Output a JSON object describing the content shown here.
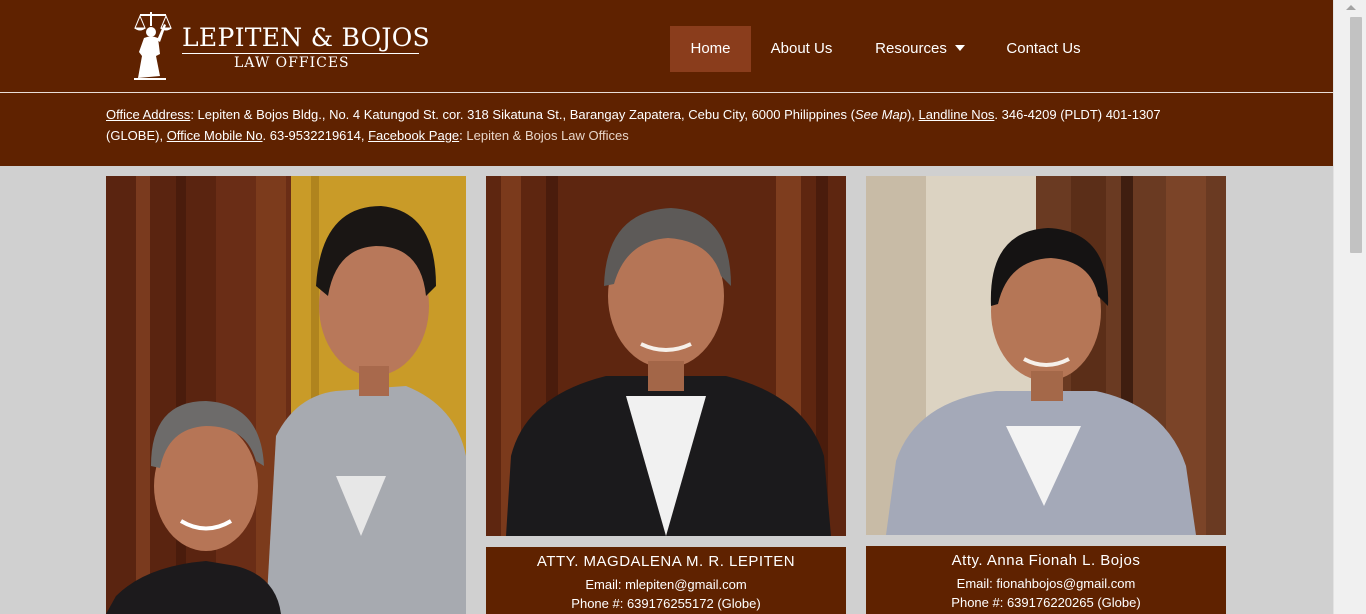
{
  "brand": {
    "title": "LEPITEN & BOJOS",
    "subtitle": "LAW OFFICES"
  },
  "nav": {
    "items": [
      {
        "label": "Home",
        "active": true
      },
      {
        "label": "About Us"
      },
      {
        "label": "Resources",
        "has_dropdown": true
      },
      {
        "label": "Contact Us"
      }
    ]
  },
  "info": {
    "office_address_label": "Office Address",
    "office_address": ": Lepiten & Bojos Bldg., No. 4 Katungod St. cor. 318 Sikatuna St., Barangay Zapatera, Cebu City, 6000 Philippines (",
    "see_map": "See Map",
    "close_paren": "), ",
    "landline_label": "Landline Nos",
    "landline": ". 346-4209 (PLDT) 401-1307 (GLOBE), ",
    "mobile_label": "Office Mobile No",
    "mobile": ". 63-9532219614, ",
    "facebook_label": "Facebook Page",
    "facebook_colon": ": ",
    "facebook": "Lepiten & Bojos Law Offices"
  },
  "profiles": [
    {
      "name": "ATTY. MAGDALENA M. R. LEPITEN",
      "email": "Email: mlepiten@gmail.com",
      "phone": "Phone #: 639176255172 (Globe)"
    },
    {
      "name": "Atty. Anna Fionah L. Bojos",
      "email": "Email: fionahbojos@gmail.com",
      "phone": "Phone #: 639176220265 (Globe)"
    }
  ],
  "colors": {
    "brand_brown": "#5f2200",
    "nav_active": "#8a3d1c",
    "page_bg": "#d0d0d0"
  }
}
